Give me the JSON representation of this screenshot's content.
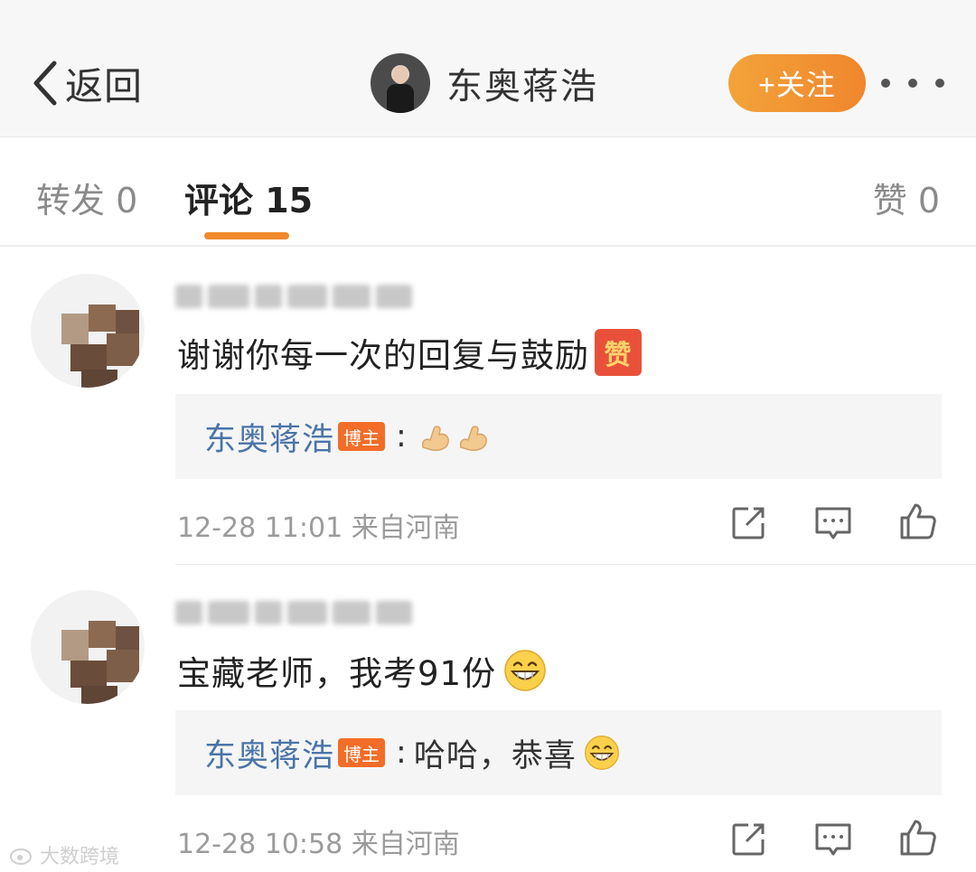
{
  "header": {
    "back_label": "返回",
    "user_name": "东奥蒋浩",
    "follow_label": "+关注",
    "more_label": "•••"
  },
  "tabs": {
    "repost": "转发 0",
    "comment": "评论 15",
    "like": "赞 0"
  },
  "comments": [
    {
      "text": "谢谢你每一次的回复与鼓励",
      "emoji": "赞",
      "reply_author": "东奥蒋浩",
      "reply_badge": "博主",
      "reply_sep": ":",
      "reply_text": "",
      "meta": "12-28 11:01 来自河南"
    },
    {
      "text": "宝藏老师，我考91份",
      "reply_author": "东奥蒋浩",
      "reply_badge": "博主",
      "reply_sep": ":",
      "reply_text": "哈哈，恭喜",
      "meta": "12-28 10:58 来自河南"
    }
  ],
  "watermark": "大数跨境",
  "colors": {
    "accent_orange": "#f08a2d",
    "link_blue": "#4a74a8",
    "badge_orange": "#f26d27"
  }
}
